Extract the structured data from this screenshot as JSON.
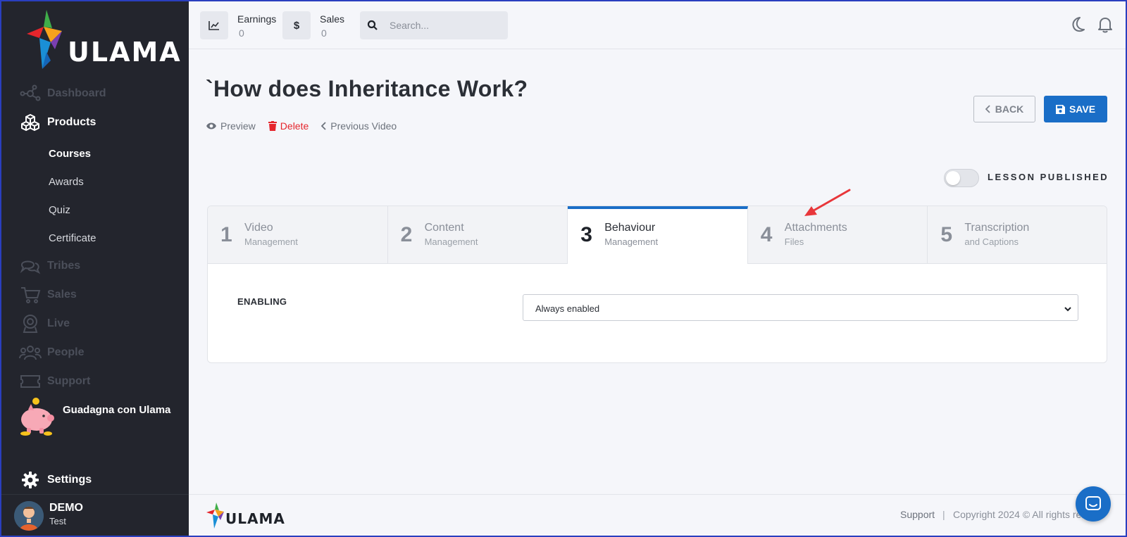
{
  "sidebar": {
    "brand": "ULAMA",
    "nav": [
      {
        "label": "Dashboard",
        "icon": "dashboard-icon"
      },
      {
        "label": "Products",
        "icon": "cubes-icon"
      },
      {
        "label": "Tribes",
        "icon": "chat-bubbles-icon"
      },
      {
        "label": "Sales",
        "icon": "cart-icon"
      },
      {
        "label": "Live",
        "icon": "webcam-icon"
      },
      {
        "label": "People",
        "icon": "people-icon"
      },
      {
        "label": "Support",
        "icon": "ticket-icon"
      }
    ],
    "products_sub": [
      "Courses",
      "Awards",
      "Quiz",
      "Certificate"
    ],
    "active_sub": "Courses",
    "promo_label": "Guadagna con Ulama",
    "settings_label": "Settings",
    "user": {
      "name": "DEMO",
      "role": "Test"
    }
  },
  "topbar": {
    "earnings": {
      "title": "Earnings",
      "value": "0"
    },
    "sales": {
      "title": "Sales",
      "value": "0",
      "icon_glyph": "$"
    },
    "search_placeholder": "Search..."
  },
  "page": {
    "title": "`How does Inheritance Work?",
    "actions": {
      "preview": "Preview",
      "delete": "Delete",
      "previous": "Previous Video"
    },
    "back_label": "BACK",
    "save_label": "SAVE",
    "toggle_label": "LESSON PUBLISHED",
    "published": false
  },
  "steps": [
    {
      "num": "1",
      "title": "Video",
      "sub": "Management",
      "active": false
    },
    {
      "num": "2",
      "title": "Content",
      "sub": "Management",
      "active": false
    },
    {
      "num": "3",
      "title": "Behaviour",
      "sub": "Management",
      "active": true
    },
    {
      "num": "4",
      "title": "Attachments",
      "sub": "Files",
      "active": false
    },
    {
      "num": "5",
      "title": "Transcription",
      "sub": "and Captions",
      "active": false
    }
  ],
  "form": {
    "enabling_label": "ENABLING",
    "enabling_value": "Always enabled"
  },
  "footer": {
    "brand": "ULAMA",
    "support": "Support",
    "separator": "|",
    "copyright": "Copyright 2024 © All rights res"
  },
  "colors": {
    "sidebar_bg": "#23252d",
    "accent": "#1a6ec7",
    "delete": "#e5252c",
    "annotation_arrow": "#e8363a"
  }
}
